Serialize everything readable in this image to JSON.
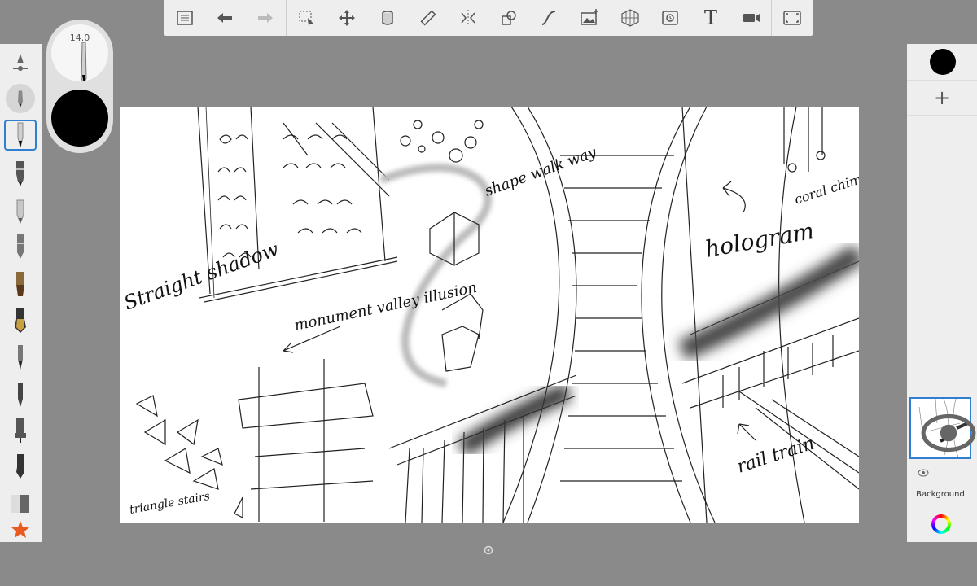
{
  "toolbar": {
    "items": [
      "layers-list",
      "undo",
      "redo",
      "selection",
      "transform",
      "fill-bucket",
      "ruler",
      "symmetry",
      "shapes",
      "stroke-line",
      "import-image",
      "perspective-grid",
      "timelapse",
      "text",
      "record",
      "fullscreen"
    ],
    "text_tool_label": "T"
  },
  "brush_panel": {
    "size_label": "14.0",
    "color": "#000000"
  },
  "left_tools": [
    "brush-settings",
    "airbrush",
    "pencil",
    "ballpoint-pen",
    "marker",
    "felt-pen",
    "paintbrush",
    "fountain-pen",
    "fine-brush",
    "ink-pen",
    "technical-pen",
    "calligraphy-pen",
    "eraser",
    "favorites"
  ],
  "right_panel": {
    "current_color": "#000000",
    "add_label": "+",
    "layers": [
      {
        "name": "",
        "visible": true,
        "selected": true
      },
      {
        "name": "Background",
        "visible": true,
        "selected": false
      }
    ]
  },
  "canvas_annotations": {
    "straight_shadow": "Straight shadow",
    "monument_valley": "monument valley illusion",
    "shape_walk_way": "shape walk way",
    "hologram": "hologram",
    "coral_chimney": "coral chimney",
    "rail_train": "rail train",
    "triangle_stairs": "triangle stairs"
  },
  "colors": {
    "accent": "#2f7fd0",
    "panel": "#eeeeee",
    "background": "#8a8a8a"
  }
}
